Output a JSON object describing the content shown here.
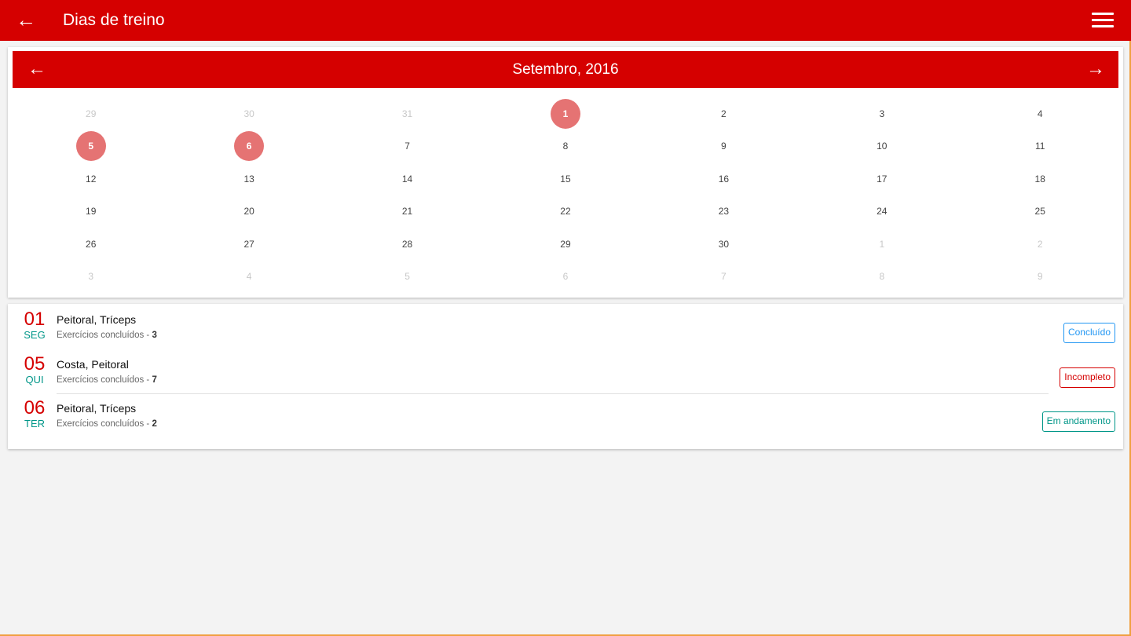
{
  "appbar": {
    "title": "Dias de treino",
    "back_icon": "arrow-left-icon",
    "menu_icon": "hamburger-menu-icon"
  },
  "calendar": {
    "month_label": "Setembro, 2016",
    "weeks": [
      [
        {
          "d": "29",
          "muted": true
        },
        {
          "d": "30",
          "muted": true
        },
        {
          "d": "31",
          "muted": true
        },
        {
          "d": "1",
          "marked": true
        },
        {
          "d": "2"
        },
        {
          "d": "3"
        },
        {
          "d": "4"
        }
      ],
      [
        {
          "d": "5",
          "marked": true
        },
        {
          "d": "6",
          "marked": true
        },
        {
          "d": "7"
        },
        {
          "d": "8"
        },
        {
          "d": "9"
        },
        {
          "d": "10"
        },
        {
          "d": "11"
        }
      ],
      [
        {
          "d": "12"
        },
        {
          "d": "13"
        },
        {
          "d": "14"
        },
        {
          "d": "15"
        },
        {
          "d": "16"
        },
        {
          "d": "17"
        },
        {
          "d": "18"
        }
      ],
      [
        {
          "d": "19"
        },
        {
          "d": "20"
        },
        {
          "d": "21"
        },
        {
          "d": "22"
        },
        {
          "d": "23"
        },
        {
          "d": "24"
        },
        {
          "d": "25"
        }
      ],
      [
        {
          "d": "26"
        },
        {
          "d": "27"
        },
        {
          "d": "28"
        },
        {
          "d": "29"
        },
        {
          "d": "30"
        },
        {
          "d": "1",
          "muted": true
        },
        {
          "d": "2",
          "muted": true
        }
      ],
      [
        {
          "d": "3",
          "muted": true
        },
        {
          "d": "4",
          "muted": true
        },
        {
          "d": "5",
          "muted": true
        },
        {
          "d": "6",
          "muted": true
        },
        {
          "d": "7",
          "muted": true
        },
        {
          "d": "8",
          "muted": true
        },
        {
          "d": "9",
          "muted": true
        }
      ]
    ]
  },
  "workouts": [
    {
      "day": "01",
      "weekday": "SEG",
      "muscles": "Peitoral, Tríceps",
      "exercises_label": "Exercícios concluídos - ",
      "exercises_count": "3",
      "status": "Concluído"
    },
    {
      "day": "05",
      "weekday": "QUI",
      "muscles": "Costa, Peitoral",
      "exercises_label": "Exercícios concluídos - ",
      "exercises_count": "7",
      "status": "Incompleto"
    },
    {
      "day": "06",
      "weekday": "TER",
      "muscles": "Peitoral, Tríceps",
      "exercises_label": "Exercícios concluídos - ",
      "exercises_count": "2",
      "status": "Em andamento"
    }
  ],
  "colors": {
    "primary": "#d50000",
    "marked_day": "#e57373",
    "weekday": "#009688",
    "status_done": "#2196f3",
    "status_incomplete": "#d50000",
    "status_progress": "#009688"
  }
}
